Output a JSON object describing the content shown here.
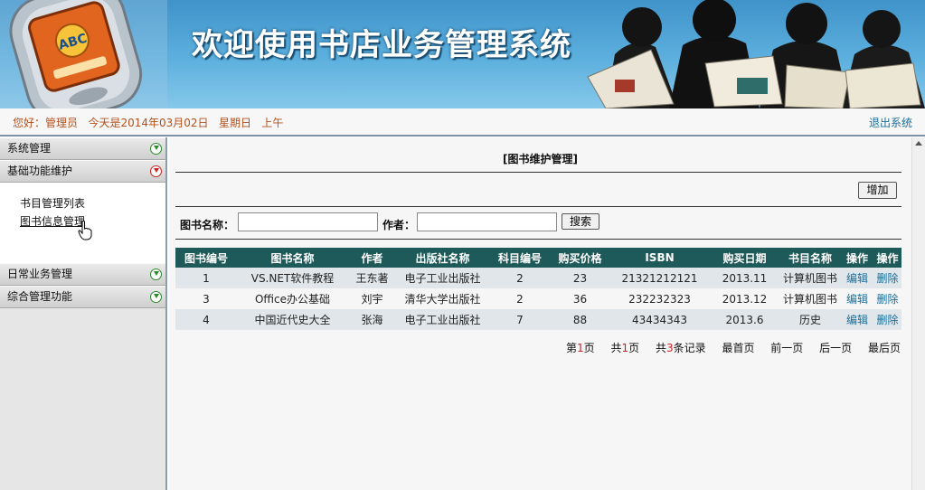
{
  "banner": {
    "title": "欢迎使用书店业务管理系统"
  },
  "status": {
    "greeting": "您好：管理员   今天是2014年03月02日   星期日   上午",
    "logout": "退出系统"
  },
  "sidebar": {
    "groups": [
      {
        "label": "系统管理",
        "expanded": false
      },
      {
        "label": "基础功能维护",
        "expanded": true,
        "items": [
          "书目管理列表",
          "图书信息管理"
        ]
      },
      {
        "label": "日常业务管理",
        "expanded": false
      },
      {
        "label": "综合管理功能",
        "expanded": false
      }
    ]
  },
  "main": {
    "title": "[图书维护管理]",
    "add_label": "增加",
    "search": {
      "name_label": "图书名称：",
      "name_value": "",
      "author_label": "作者：",
      "author_value": "",
      "button": "搜索"
    },
    "table": {
      "headers": [
        "图书编号",
        "图书名称",
        "作者",
        "出版社名称",
        "科目编号",
        "购买价格",
        "ISBN",
        "购买日期",
        "书目名称",
        "操作",
        "操作"
      ],
      "rows": [
        {
          "id": "1",
          "name": "VS.NET软件教程",
          "author": "王东著",
          "publisher": "电子工业出版社",
          "subject": "2",
          "price": "23",
          "isbn": "21321212121",
          "date": "2013.11",
          "category": "计算机图书",
          "edit": "编辑",
          "delete": "删除"
        },
        {
          "id": "3",
          "name": "Office办公基础",
          "author": "刘宇",
          "publisher": "清华大学出版社",
          "subject": "2",
          "price": "36",
          "isbn": "232232323",
          "date": "2013.12",
          "category": "计算机图书",
          "edit": "编辑",
          "delete": "删除"
        },
        {
          "id": "4",
          "name": "中国近代史大全",
          "author": "张海",
          "publisher": "电子工业出版社",
          "subject": "7",
          "price": "88",
          "isbn": "43434343",
          "date": "2013.6",
          "category": "历史",
          "edit": "编辑",
          "delete": "删除"
        }
      ]
    },
    "pager": {
      "page_prefix": "第",
      "current_page": "1",
      "page_suffix": "页",
      "total_prefix": "共",
      "total_pages": "1",
      "total_suffix": "页",
      "records_prefix": "共",
      "records": "3",
      "records_suffix": "条记录",
      "first": "最首页",
      "prev": "前一页",
      "next": "后一页",
      "last": "最后页"
    }
  },
  "colors": {
    "header_bg": "#1e5a59",
    "greeting": "#b4501c",
    "link": "#1b6f9a",
    "accent_red": "#cc2222"
  }
}
